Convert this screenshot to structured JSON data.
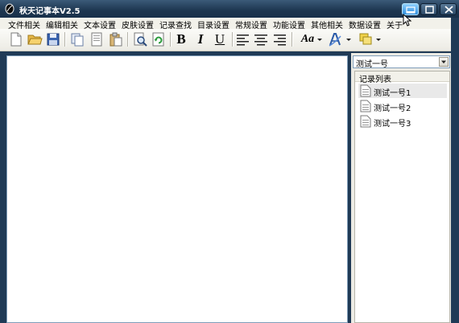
{
  "window": {
    "title": "秋天记事本V2.5",
    "buttons": {
      "minimize": "minimize",
      "maximize": "maximize",
      "close": "close"
    }
  },
  "menubar": {
    "items": [
      "文件相关",
      "编辑相关",
      "文本设置",
      "皮肤设置",
      "记录查找",
      "目录设置",
      "常规设置",
      "功能设置",
      "其他相关",
      "数据设置",
      "关于"
    ]
  },
  "toolbar": {
    "bold_label": "B",
    "italic_label": "I",
    "underline_label": "U",
    "font_label": "Aa"
  },
  "sidebar": {
    "select_value": "测试一号",
    "list_title": "记录列表",
    "items": [
      {
        "label": "测试一号1",
        "selected": true
      },
      {
        "label": "测试一号2",
        "selected": false
      },
      {
        "label": "测试一号3",
        "selected": false
      }
    ]
  },
  "editor": {
    "value": ""
  },
  "colors": {
    "titlebar": "#1d3650",
    "menubar": "#f2f1ea",
    "accent": "#2f8fdd"
  }
}
